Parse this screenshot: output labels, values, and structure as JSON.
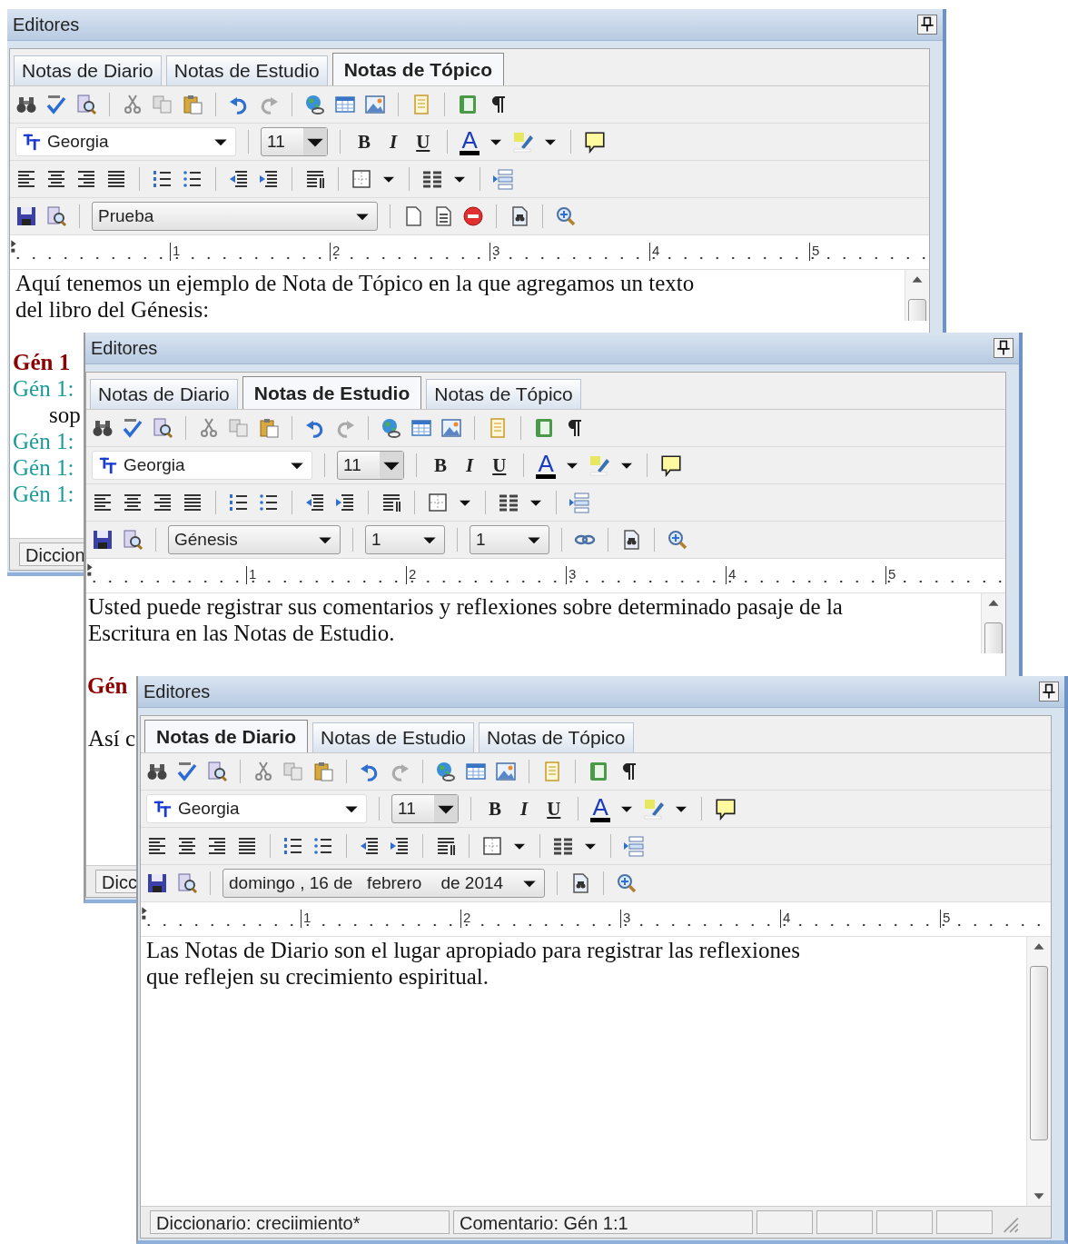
{
  "windows": [
    {
      "kind": "topic",
      "title": "Editores",
      "tabs": [
        {
          "label": "Notas de Diario",
          "selected": false
        },
        {
          "label": "Notas de Estudio",
          "selected": false
        },
        {
          "label": "Notas de Tópico",
          "selected": true
        }
      ],
      "font": "Georgia",
      "size": "11",
      "format_buttons": [
        "B",
        "I",
        "U"
      ],
      "font_color_label": "A",
      "record_fields": [
        "Prueba"
      ],
      "ruler": [
        "1",
        "2",
        "3",
        "4",
        "5"
      ],
      "content": [
        {
          "kind": "text",
          "text": "Aquí tenemos un ejemplo de Nota de Tópico en la que agregamos un texto del libro del Génesis:"
        },
        {
          "kind": "blank"
        },
        {
          "kind": "heading",
          "text": "Gén 1"
        },
        {
          "kind": "ref",
          "text": "Gén 1:"
        },
        {
          "kind": "verse",
          "text": "sop"
        },
        {
          "kind": "ref",
          "text": "Gén 1:"
        },
        {
          "kind": "ref",
          "text": "Gén 1:"
        },
        {
          "kind": "ref",
          "text": "Gén 1:"
        }
      ],
      "status": [
        "Diccion"
      ]
    },
    {
      "kind": "study",
      "title": "Editores",
      "tabs": [
        {
          "label": "Notas de Diario",
          "selected": false
        },
        {
          "label": "Notas de Estudio",
          "selected": true
        },
        {
          "label": "Notas de Tópico",
          "selected": false
        }
      ],
      "font": "Georgia",
      "size": "11",
      "format_buttons": [
        "B",
        "I",
        "U"
      ],
      "font_color_label": "A",
      "record_fields": [
        "Génesis",
        "1",
        "1"
      ],
      "ruler": [
        "1",
        "2",
        "3",
        "4",
        "5"
      ],
      "content": [
        {
          "kind": "text",
          "text": "Usted puede registrar sus comentarios y reflexiones sobre determinado pasaje de la Escritura en las Notas de Estudio."
        },
        {
          "kind": "blank"
        },
        {
          "kind": "heading",
          "text": "Gén"
        },
        {
          "kind": "blank"
        },
        {
          "kind": "text",
          "text": "Así c"
        }
      ],
      "status": [
        "Dicc"
      ]
    },
    {
      "kind": "diary",
      "title": "Editores",
      "tabs": [
        {
          "label": "Notas de Diario",
          "selected": true
        },
        {
          "label": "Notas de Estudio",
          "selected": false
        },
        {
          "label": "Notas de Tópico",
          "selected": false
        }
      ],
      "font": "Georgia",
      "size": "11",
      "format_buttons": [
        "B",
        "I",
        "U"
      ],
      "font_color_label": "A",
      "record_fields": [
        "domingo , 16 de   febrero    de 2014"
      ],
      "ruler": [
        "1",
        "2",
        "3",
        "4",
        "5"
      ],
      "content": [
        {
          "kind": "text",
          "text": "Las Notas de Diario son el lugar apropiado para registrar las reflexiones que reflejen su crecimiento espiritual."
        }
      ],
      "status": [
        "Diccionario: creciimiento*",
        "Comentario: Gén 1:1"
      ]
    }
  ]
}
